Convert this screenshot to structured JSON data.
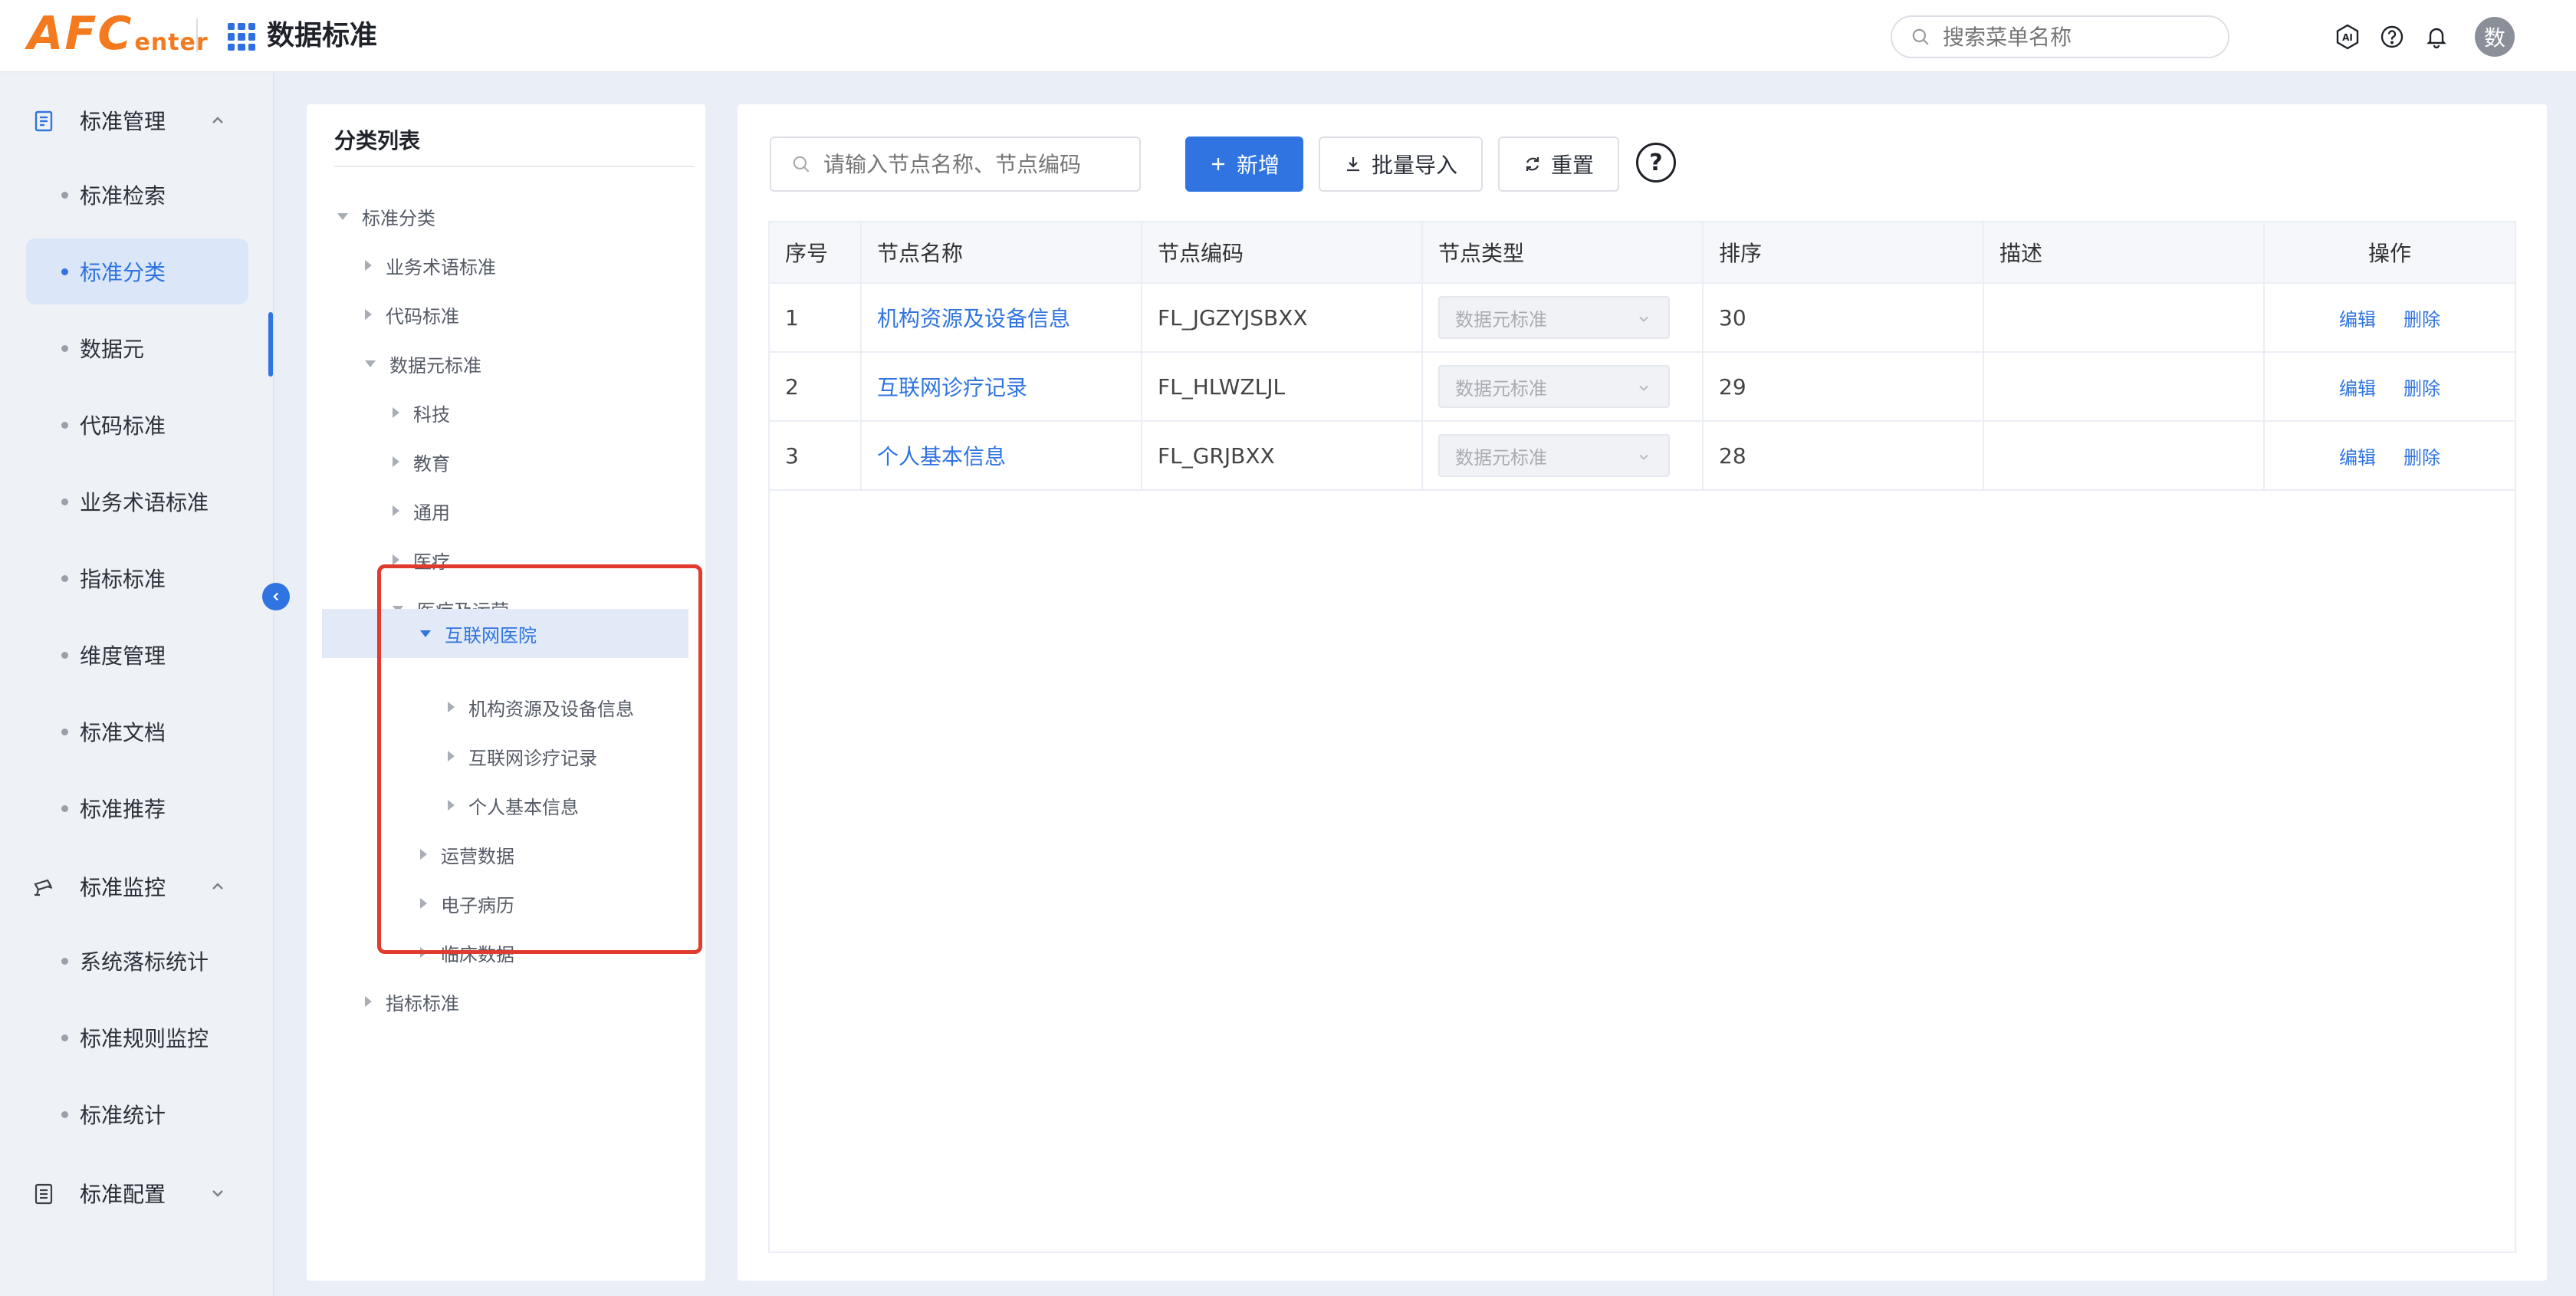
{
  "header": {
    "logo_main": "AFC",
    "logo_sub": "enter",
    "app_title": "数据标准",
    "search_placeholder": "搜索菜单名称",
    "avatar_text": "数"
  },
  "sidebar": {
    "groups": [
      {
        "label": "标准管理",
        "items": [
          "标准检索",
          "标准分类",
          "数据元",
          "代码标准",
          "业务术语标准",
          "指标标准",
          "维度管理",
          "标准文档",
          "标准推荐"
        ]
      },
      {
        "label": "标准监控",
        "items": [
          "系统落标统计",
          "标准规则监控",
          "标准统计"
        ]
      },
      {
        "label": "标准配置",
        "items": []
      }
    ],
    "active_item": "标准分类"
  },
  "tree": {
    "title": "分类列表",
    "nodes": [
      {
        "label": "标准分类"
      },
      {
        "label": "业务术语标准"
      },
      {
        "label": "代码标准"
      },
      {
        "label": "数据元标准"
      },
      {
        "label": "科技"
      },
      {
        "label": "教育"
      },
      {
        "label": "通用"
      },
      {
        "label": "医疗"
      },
      {
        "label": "医疗及运营"
      },
      {
        "label": "互联网医院"
      },
      {
        "label": "机构资源及设备信息"
      },
      {
        "label": "互联网诊疗记录"
      },
      {
        "label": "个人基本信息"
      },
      {
        "label": "运营数据"
      },
      {
        "label": "电子病历"
      },
      {
        "label": "临床数据"
      },
      {
        "label": "指标标准"
      }
    ]
  },
  "toolbar": {
    "search_placeholder": "请输入节点名称、节点编码",
    "add_label": "新增",
    "import_label": "批量导入",
    "reset_label": "重置",
    "help_symbol": "?"
  },
  "table": {
    "columns": [
      "序号",
      "节点名称",
      "节点编码",
      "节点类型",
      "排序",
      "描述",
      "操作"
    ],
    "rows": [
      {
        "index": "1",
        "name": "机构资源及设备信息",
        "code": "FL_JGZYJSBXX",
        "type": "数据元标准",
        "sort": "30",
        "desc": "",
        "edit": "编辑",
        "delete": "删除"
      },
      {
        "index": "2",
        "name": "互联网诊疗记录",
        "code": "FL_HLWZLJL",
        "type": "数据元标准",
        "sort": "29",
        "desc": "",
        "edit": "编辑",
        "delete": "删除"
      },
      {
        "index": "3",
        "name": "个人基本信息",
        "code": "FL_GRJBXX",
        "type": "数据元标准",
        "sort": "28",
        "desc": "",
        "edit": "编辑",
        "delete": "删除"
      }
    ]
  },
  "colors": {
    "primary": "#2f74e0",
    "logo": "#f47a1f",
    "highlight_border": "#e13a2e"
  }
}
